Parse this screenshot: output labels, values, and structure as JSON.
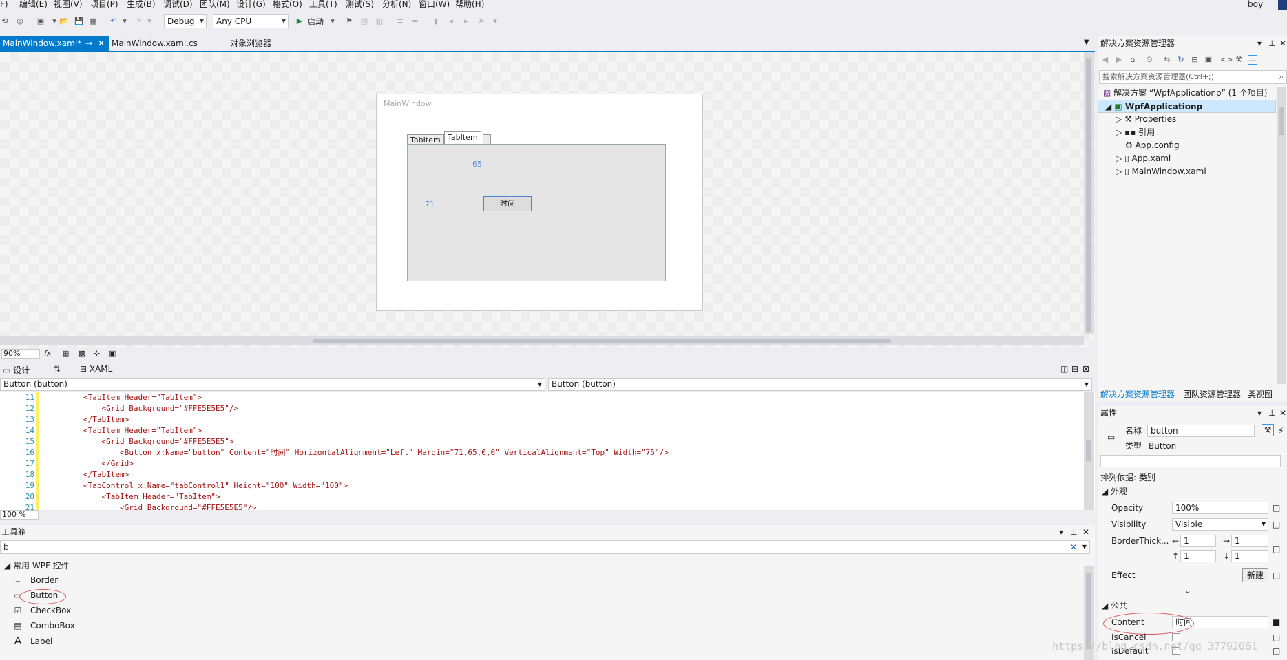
{
  "menu": [
    "F)",
    "编辑(E)",
    "视图(V)",
    "项目(P)",
    "生成(B)",
    "调试(D)",
    "团队(M)",
    "设计(G)",
    "格式(O)",
    "工具(T)",
    "测试(S)",
    "分析(N)",
    "窗口(W)",
    "帮助(H)"
  ],
  "user": "boy",
  "toolbar": {
    "config": "Debug",
    "platform": "Any CPU",
    "start": "启动"
  },
  "doc_tabs": [
    {
      "label": "MainWindow.xaml*",
      "active": true
    },
    {
      "label": "MainWindow.xaml.cs",
      "active": false
    },
    {
      "label": "对象浏览器",
      "active": false
    }
  ],
  "designer": {
    "window_title": "MainWindow",
    "tab1": "TabItem",
    "tab2": "TabItem",
    "button_label": "时间",
    "margin_top": "65",
    "margin_left": "71",
    "zoom": "90%"
  },
  "split": {
    "design_tab": "设计",
    "swap": "⇅",
    "xaml_tab": "XAML"
  },
  "crumbs": {
    "left": "Button (button)",
    "right": "Button (button)"
  },
  "code": [
    {
      "n": "11",
      "t": "        <TabItem Header=\"TabItem\">"
    },
    {
      "n": "12",
      "t": "            <Grid Background=\"#FFE5E5E5\"/>"
    },
    {
      "n": "13",
      "t": "        </TabItem>"
    },
    {
      "n": "14",
      "t": "        <TabItem Header=\"TabItem\">"
    },
    {
      "n": "15",
      "t": "            <Grid Background=\"#FFE5E5E5\">"
    },
    {
      "n": "16",
      "t": "                <Button x:Name=\"button\" Content=\"时间\" HorizontalAlignment=\"Left\" Margin=\"71,65,0,0\" VerticalAlignment=\"Top\" Width=\"75\"/>"
    },
    {
      "n": "17",
      "t": "            </Grid>"
    },
    {
      "n": "18",
      "t": "        </TabItem>"
    },
    {
      "n": "19",
      "t": "        <TabControl x:Name=\"tabControl1\" Height=\"100\" Width=\"100\">"
    },
    {
      "n": "20",
      "t": "            <TabItem Header=\"TabItem\">"
    },
    {
      "n": "21",
      "t": "                <Grid Background=\"#FFE5E5E5\"/>"
    }
  ],
  "code_zoom": "100 %",
  "toolbox": {
    "title": "工具箱",
    "search": "b",
    "category": "常用 WPF 控件",
    "items": [
      "Border",
      "Button",
      "CheckBox",
      "ComboBox",
      "Label"
    ]
  },
  "solution": {
    "title": "解决方案资源管理器",
    "search_placeholder": "搜索解决方案资源管理器(Ctrl+;)",
    "root": "解决方案 “WpfApplicationp” (1 个项目)",
    "project": "WpfApplicationp",
    "items": [
      "Properties",
      "引用",
      "App.config",
      "App.xaml",
      "MainWindow.xaml"
    ],
    "tabs": [
      "解决方案资源管理器",
      "团队资源管理器",
      "类视图"
    ]
  },
  "properties": {
    "title": "属性",
    "name_label": "名称",
    "name_value": "button",
    "type_label": "类型",
    "type_value": "Button",
    "arrange": "排列依据: 类别",
    "group_appearance": "外观",
    "opacity_label": "Opacity",
    "opacity_value": "100%",
    "visibility_label": "Visibility",
    "visibility_value": "Visible",
    "border_label": "BorderThick...",
    "border_values": [
      "1",
      "1",
      "1",
      "1"
    ],
    "effect_label": "Effect",
    "effect_button": "新建",
    "group_common": "公共",
    "content_label": "Content",
    "content_value": "时间",
    "iscancel_label": "IsCancel",
    "isdefault_label": "IsDefault"
  },
  "watermark": "https://blog.csdn.net/qq_37792061",
  "colors": {
    "accent": "#007acc",
    "annotation": "#e05050"
  }
}
